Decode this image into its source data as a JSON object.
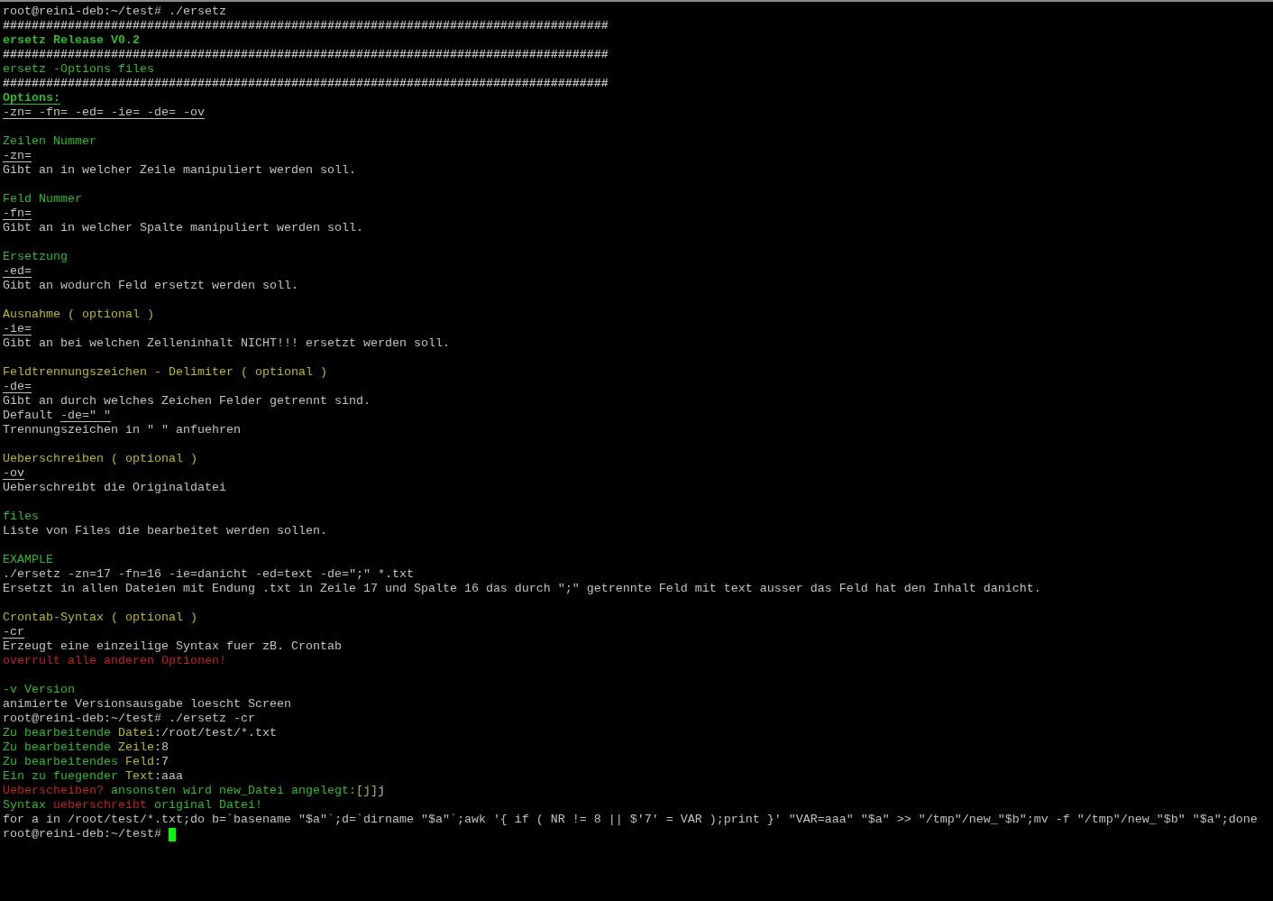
{
  "terminal": {
    "cursor": {
      "visible": true,
      "color": "#00ff00"
    },
    "lines": [
      {
        "kind": "text",
        "segments": [
          {
            "text": "root@reini-deb:~/test# ./ersetz",
            "color": "#c0c0c0",
            "bold": false,
            "underline": false
          }
        ]
      },
      {
        "kind": "text",
        "segments": [
          {
            "text": "####################################################################################",
            "color": "#c0c0c0",
            "bold": true,
            "underline": false
          }
        ]
      },
      {
        "kind": "text",
        "segments": [
          {
            "text": "ersetz Release V0.2",
            "color": "#2eb82e",
            "bold": true,
            "underline": false
          }
        ]
      },
      {
        "kind": "text",
        "segments": [
          {
            "text": "####################################################################################",
            "color": "#c0c0c0",
            "bold": true,
            "underline": false
          }
        ]
      },
      {
        "kind": "text",
        "segments": [
          {
            "text": "ersetz -Options files",
            "color": "#2eb82e",
            "bold": false,
            "underline": false
          }
        ]
      },
      {
        "kind": "text",
        "segments": [
          {
            "text": "####################################################################################",
            "color": "#c0c0c0",
            "bold": true,
            "underline": false
          }
        ]
      },
      {
        "kind": "text",
        "segments": [
          {
            "text": "Options:",
            "color": "#2eb82e",
            "bold": true,
            "underline": true
          }
        ]
      },
      {
        "kind": "text",
        "segments": [
          {
            "text": "-zn= -fn= -ed= -ie= -de= -ov",
            "color": "#c0c0c0",
            "bold": false,
            "underline": true
          }
        ]
      },
      {
        "kind": "blank"
      },
      {
        "kind": "text",
        "segments": [
          {
            "text": "Zeilen Nummer",
            "color": "#2eb82e",
            "bold": false,
            "underline": false
          }
        ]
      },
      {
        "kind": "text",
        "segments": [
          {
            "text": "-zn=",
            "color": "#c0c0c0",
            "bold": false,
            "underline": true
          }
        ]
      },
      {
        "kind": "text",
        "segments": [
          {
            "text": "Gibt an in welcher Zeile manipuliert werden soll.",
            "color": "#c0c0c0",
            "bold": false,
            "underline": false
          }
        ]
      },
      {
        "kind": "blank"
      },
      {
        "kind": "text",
        "segments": [
          {
            "text": "Feld Nummer",
            "color": "#2eb82e",
            "bold": false,
            "underline": false
          }
        ]
      },
      {
        "kind": "text",
        "segments": [
          {
            "text": "-fn=",
            "color": "#c0c0c0",
            "bold": false,
            "underline": true
          }
        ]
      },
      {
        "kind": "text",
        "segments": [
          {
            "text": "Gibt an in welcher Spalte manipuliert werden soll.",
            "color": "#c0c0c0",
            "bold": false,
            "underline": false
          }
        ]
      },
      {
        "kind": "blank"
      },
      {
        "kind": "text",
        "segments": [
          {
            "text": "Ersetzung",
            "color": "#2eb82e",
            "bold": false,
            "underline": false
          }
        ]
      },
      {
        "kind": "text",
        "segments": [
          {
            "text": "-ed=",
            "color": "#c0c0c0",
            "bold": false,
            "underline": true
          }
        ]
      },
      {
        "kind": "text",
        "segments": [
          {
            "text": "Gibt an wodurch Feld ersetzt werden soll.",
            "color": "#c0c0c0",
            "bold": false,
            "underline": false
          }
        ]
      },
      {
        "kind": "blank"
      },
      {
        "kind": "text",
        "segments": [
          {
            "text": "Ausnahme ( optional )",
            "color": "#b8b82a",
            "bold": false,
            "underline": false
          }
        ]
      },
      {
        "kind": "text",
        "segments": [
          {
            "text": "-ie=",
            "color": "#c0c0c0",
            "bold": false,
            "underline": true
          }
        ]
      },
      {
        "kind": "text",
        "segments": [
          {
            "text": "Gibt an bei welchen Zelleninhalt NICHT!!! ersetzt werden soll.",
            "color": "#c0c0c0",
            "bold": false,
            "underline": false
          }
        ]
      },
      {
        "kind": "blank"
      },
      {
        "kind": "text",
        "segments": [
          {
            "text": "Feldtrennungszeichen - Delimiter ( optional )",
            "color": "#b8b82a",
            "bold": false,
            "underline": false
          }
        ]
      },
      {
        "kind": "text",
        "segments": [
          {
            "text": "-de=",
            "color": "#c0c0c0",
            "bold": false,
            "underline": true
          }
        ]
      },
      {
        "kind": "text",
        "segments": [
          {
            "text": "Gibt an durch welches Zeichen Felder getrennt sind.",
            "color": "#c0c0c0",
            "bold": false,
            "underline": false
          }
        ]
      },
      {
        "kind": "text",
        "segments": [
          {
            "text": "Default ",
            "color": "#c0c0c0",
            "bold": false,
            "underline": false
          },
          {
            "text": "-de=\" \"",
            "color": "#c0c0c0",
            "bold": false,
            "underline": true
          }
        ]
      },
      {
        "kind": "text",
        "segments": [
          {
            "text": "Trennungszeichen in \" \" anfuehren",
            "color": "#c0c0c0",
            "bold": false,
            "underline": false
          }
        ]
      },
      {
        "kind": "blank"
      },
      {
        "kind": "text",
        "segments": [
          {
            "text": "Ueberschreiben ( optional )",
            "color": "#b8b82a",
            "bold": false,
            "underline": false
          }
        ]
      },
      {
        "kind": "text",
        "segments": [
          {
            "text": "-ov",
            "color": "#c0c0c0",
            "bold": false,
            "underline": true
          }
        ]
      },
      {
        "kind": "text",
        "segments": [
          {
            "text": "Ueberschreibt die Originaldatei",
            "color": "#c0c0c0",
            "bold": false,
            "underline": false
          }
        ]
      },
      {
        "kind": "blank"
      },
      {
        "kind": "text",
        "segments": [
          {
            "text": "files",
            "color": "#2eb82e",
            "bold": false,
            "underline": false
          }
        ]
      },
      {
        "kind": "text",
        "segments": [
          {
            "text": "Liste von Files die bearbeitet werden sollen.",
            "color": "#c0c0c0",
            "bold": false,
            "underline": false
          }
        ]
      },
      {
        "kind": "blank"
      },
      {
        "kind": "text",
        "segments": [
          {
            "text": "EXAMPLE",
            "color": "#2eb82e",
            "bold": false,
            "underline": false
          }
        ]
      },
      {
        "kind": "text",
        "segments": [
          {
            "text": "./ersetz -zn=17 -fn=16 -ie=danicht -ed=text -de=\";\" *.txt",
            "color": "#c0c0c0",
            "bold": false,
            "underline": false
          }
        ]
      },
      {
        "kind": "text",
        "segments": [
          {
            "text": "Ersetzt in allen Dateien mit Endung .txt in Zeile 17 und Spalte 16 das durch \";\" getrennte Feld mit text ausser das Feld hat den Inhalt danicht.",
            "color": "#c0c0c0",
            "bold": false,
            "underline": false
          }
        ]
      },
      {
        "kind": "blank"
      },
      {
        "kind": "text",
        "segments": [
          {
            "text": "Crontab-Syntax ( optional )",
            "color": "#b8b82a",
            "bold": false,
            "underline": false
          }
        ]
      },
      {
        "kind": "text",
        "segments": [
          {
            "text": "-cr",
            "color": "#c0c0c0",
            "bold": false,
            "underline": true
          }
        ]
      },
      {
        "kind": "text",
        "segments": [
          {
            "text": "Erzeugt eine einzeilige Syntax fuer zB. Crontab",
            "color": "#c0c0c0",
            "bold": false,
            "underline": false
          }
        ]
      },
      {
        "kind": "text",
        "segments": [
          {
            "text": "overrult alle anderen Optionen!",
            "color": "#c02020",
            "bold": false,
            "underline": false
          }
        ]
      },
      {
        "kind": "blank"
      },
      {
        "kind": "text",
        "segments": [
          {
            "text": "-v Version",
            "color": "#2eb82e",
            "bold": false,
            "underline": false
          }
        ]
      },
      {
        "kind": "text",
        "segments": [
          {
            "text": "animierte Versionsausgabe loescht Screen",
            "color": "#c0c0c0",
            "bold": false,
            "underline": false
          }
        ]
      },
      {
        "kind": "text",
        "segments": [
          {
            "text": "root@reini-deb:~/test# ./ersetz -cr",
            "color": "#c0c0c0",
            "bold": false,
            "underline": false
          }
        ]
      },
      {
        "kind": "text",
        "segments": [
          {
            "text": "Zu bearbeitende ",
            "color": "#2eb82e",
            "bold": false,
            "underline": false
          },
          {
            "text": "Datei",
            "color": "#b8b82a",
            "bold": false,
            "underline": false
          },
          {
            "text": ":/root/test/*.txt",
            "color": "#c0c0c0",
            "bold": false,
            "underline": false
          }
        ]
      },
      {
        "kind": "text",
        "segments": [
          {
            "text": "Zu bearbeitende ",
            "color": "#2eb82e",
            "bold": false,
            "underline": false
          },
          {
            "text": "Zeile",
            "color": "#b8b82a",
            "bold": false,
            "underline": false
          },
          {
            "text": ":8",
            "color": "#c0c0c0",
            "bold": false,
            "underline": false
          }
        ]
      },
      {
        "kind": "text",
        "segments": [
          {
            "text": "Zu bearbeitendes ",
            "color": "#2eb82e",
            "bold": false,
            "underline": false
          },
          {
            "text": "Feld",
            "color": "#b8b82a",
            "bold": false,
            "underline": false
          },
          {
            "text": ":7",
            "color": "#c0c0c0",
            "bold": false,
            "underline": false
          }
        ]
      },
      {
        "kind": "text",
        "segments": [
          {
            "text": "Ein zu fuegender ",
            "color": "#2eb82e",
            "bold": false,
            "underline": false
          },
          {
            "text": "Text",
            "color": "#b8b82a",
            "bold": false,
            "underline": false
          },
          {
            "text": ":aaa",
            "color": "#c0c0c0",
            "bold": false,
            "underline": false
          }
        ]
      },
      {
        "kind": "text",
        "segments": [
          {
            "text": "Ueberscheiben?",
            "color": "#c02020",
            "bold": false,
            "underline": false
          },
          {
            "text": " ansonsten wird new_Datei angelegt:",
            "color": "#2eb82e",
            "bold": false,
            "underline": false
          },
          {
            "text": "[j]",
            "color": "#b8b82a",
            "bold": false,
            "underline": false
          },
          {
            "text": "j",
            "color": "#c0c0c0",
            "bold": false,
            "underline": false
          }
        ]
      },
      {
        "kind": "text",
        "segments": [
          {
            "text": "Syntax ",
            "color": "#2eb82e",
            "bold": false,
            "underline": false
          },
          {
            "text": "ueberschreibt",
            "color": "#c02020",
            "bold": false,
            "underline": false
          },
          {
            "text": " original Datei!",
            "color": "#2eb82e",
            "bold": false,
            "underline": false
          }
        ]
      },
      {
        "kind": "text",
        "segments": [
          {
            "text": "for a in /root/test/*.txt;do b=`basename \"$a\"`;d=`dirname \"$a\"`;awk '{ if ( NR != 8 || $'7' = VAR );print }' \"VAR=aaa\" \"$a\" >> \"/tmp\"/new_\"$b\";mv -f \"/tmp\"/new_\"$b\" \"$a\";done",
            "color": "#c0c0c0",
            "bold": false,
            "underline": false
          }
        ]
      },
      {
        "kind": "text",
        "segments": [
          {
            "text": "root@reini-deb:~/test# ",
            "color": "#c0c0c0",
            "bold": false,
            "underline": false
          }
        ]
      }
    ]
  }
}
